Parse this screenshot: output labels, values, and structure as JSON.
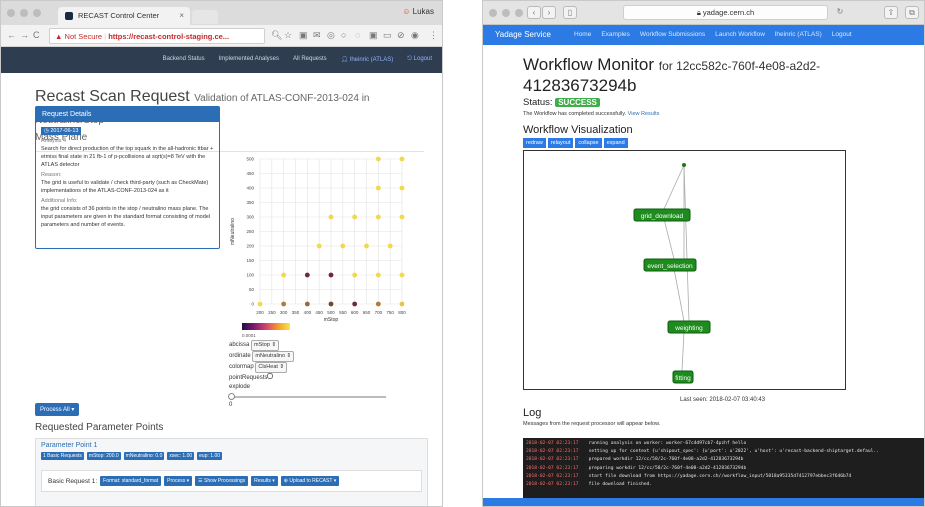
{
  "left": {
    "tab_title": "RECAST Control Center",
    "profile_name": "Lukas",
    "url": {
      "not_secure": "Not Secure",
      "text": "https://recast-control-staging.ce..."
    },
    "nav": [
      "Backend Status",
      "Implemented Analyses",
      "All Requests",
      "lheinric (ATLAS)",
      "Logout"
    ],
    "page_title": "Recast Scan Request",
    "page_title_small": "Validation of ATLAS-CONF-2013-024 in Neutralino/Stop",
    "page_subtitle": "Mass Plane",
    "request_details": {
      "header": "Request Details",
      "date": "2017-06-13",
      "analysis_label": "Analysis 4",
      "analysis_text": "Search for direct production of the top squark in the all-hadronic ttbar + etmiss final state in 21 fb-1 of p-pcollisions at sqrt(s)=8 TeV with the ATLAS detector",
      "reason_label": "Reason:",
      "reason_text": "The grid is useful to validate / check third-party (such as CheckMate) implementations of the ATLAS-CONF-2013-024 as it",
      "info_label": "Additional Info:",
      "info_text": "the grid consists of 36 points in the stop / neutralino mass plane. The input parameters are given in the standard format consisting of model parameters and number of events."
    },
    "controls": {
      "colorbar_tick": "0.0001",
      "abcissa_label": "abcissa",
      "abcissa_value": "mStop",
      "ordinate_label": "ordinate",
      "ordinate_value": "mNeutralino",
      "colormap_label": "colormap",
      "colormap_value": "ClsHeat",
      "point_label": "pointRequests",
      "explode_label": "explode",
      "explode_value": "0"
    },
    "process_all": "Process All ▾",
    "rpp_title": "Requested Parameter Points",
    "param_point": {
      "title": "Parameter Point 1",
      "badges": [
        "1 Basic Requests",
        "mStop: 200.0",
        "mNeutralino: 0.0",
        "xsec: 1.00",
        "eup: 1.00"
      ],
      "basic_request_label": "Basic Request 1:",
      "buttons": [
        "Format: standard_format",
        "Process ▾",
        "Show Processings",
        "Results ▾",
        "Upload to RECAST ▾"
      ]
    }
  },
  "chart_data": {
    "type": "scatter",
    "title": "",
    "xlabel": "mStop",
    "ylabel": "mNeutralino",
    "xlim": [
      200,
      800
    ],
    "ylim": [
      0,
      500
    ],
    "x_ticks": [
      200,
      250,
      300,
      350,
      400,
      450,
      500,
      550,
      600,
      650,
      700,
      750,
      800
    ],
    "y_ticks": [
      0,
      50,
      100,
      150,
      200,
      250,
      300,
      350,
      400,
      450,
      500
    ],
    "points": [
      {
        "x": 200,
        "y": 0,
        "c": "#f2d94a"
      },
      {
        "x": 300,
        "y": 0,
        "c": "#b07b3a"
      },
      {
        "x": 400,
        "y": 0,
        "c": "#9a6b3a"
      },
      {
        "x": 500,
        "y": 0,
        "c": "#6b4a35"
      },
      {
        "x": 600,
        "y": 0,
        "c": "#6e2b3a"
      },
      {
        "x": 700,
        "y": 0,
        "c": "#b07b3a"
      },
      {
        "x": 800,
        "y": 0,
        "c": "#e6c548"
      },
      {
        "x": 300,
        "y": 100,
        "c": "#f2d94a"
      },
      {
        "x": 400,
        "y": 100,
        "c": "#6e2b3a"
      },
      {
        "x": 500,
        "y": 100,
        "c": "#7a2040"
      },
      {
        "x": 600,
        "y": 100,
        "c": "#f2d94a"
      },
      {
        "x": 700,
        "y": 100,
        "c": "#f2d94a"
      },
      {
        "x": 800,
        "y": 100,
        "c": "#f2d94a"
      },
      {
        "x": 450,
        "y": 200,
        "c": "#f2d94a"
      },
      {
        "x": 550,
        "y": 200,
        "c": "#f2d94a"
      },
      {
        "x": 650,
        "y": 200,
        "c": "#f2d94a"
      },
      {
        "x": 750,
        "y": 200,
        "c": "#f2d94a"
      },
      {
        "x": 500,
        "y": 300,
        "c": "#f2d94a"
      },
      {
        "x": 600,
        "y": 300,
        "c": "#f2d94a"
      },
      {
        "x": 700,
        "y": 300,
        "c": "#f2d94a"
      },
      {
        "x": 800,
        "y": 300,
        "c": "#f2d94a"
      },
      {
        "x": 700,
        "y": 400,
        "c": "#f2d94a"
      },
      {
        "x": 800,
        "y": 400,
        "c": "#f2d94a"
      },
      {
        "x": 700,
        "y": 500,
        "c": "#f2d94a"
      },
      {
        "x": 800,
        "y": 500,
        "c": "#f2d94a"
      }
    ]
  },
  "right": {
    "url": "yadage.cern.ch",
    "brand": "Yadage Service",
    "nav": [
      "Home",
      "Examples",
      "Workflow Submissions",
      "Launch Workflow",
      "lheinric (ATLAS)",
      "Logout"
    ],
    "title": "Workflow Monitor",
    "title_small": "for 12cc582c-760f-4e08-a2d2-",
    "title_cont": "41283673294b",
    "status_label": "Status:",
    "status_value": "SUCCESS",
    "completed_text": "The Workflow has completed successfully.",
    "view_results": "View Results",
    "viz_title": "Workflow Visualization",
    "viz_buttons": [
      "redraw",
      "relayout",
      "collapse",
      "expand"
    ],
    "nodes": [
      "grid_download",
      "event_selection",
      "weighting",
      "fitting"
    ],
    "last_seen": "Last seen: 2018-02-07 03:40:43",
    "log_title": "Log",
    "log_sub": "Messages from the request processor will appear below.",
    "log_lines": [
      {
        "ts": "2018-02-07 02:23:17",
        "msg": "running analysis on worker: worker-67c4d97cb7-4pzhf hello"
      },
      {
        "ts": "2018-02-07 02:23:17",
        "msg": "setting up for context {u'shipout_spec': {u'port': u'2022', u'host': u'recast-backend-shiptarget.defaul.."
      },
      {
        "ts": "2018-02-07 02:23:17",
        "msg": "prepared workdir 12/cc/58/2c-760f-4e08-a2d2-41283673294b"
      },
      {
        "ts": "2018-02-07 02:23:17",
        "msg": "preparing workdir 12/cc/58/2c-760f-4e08-a2d2-41283673294b"
      },
      {
        "ts": "2018-02-07 02:23:17",
        "msg": "start file download from  https://yadage.cern.ch//workflow_input/5018a95335d7412797ebbec3f646b74"
      },
      {
        "ts": "2018-02-07 02:23:17",
        "msg": "file download finished."
      }
    ]
  }
}
